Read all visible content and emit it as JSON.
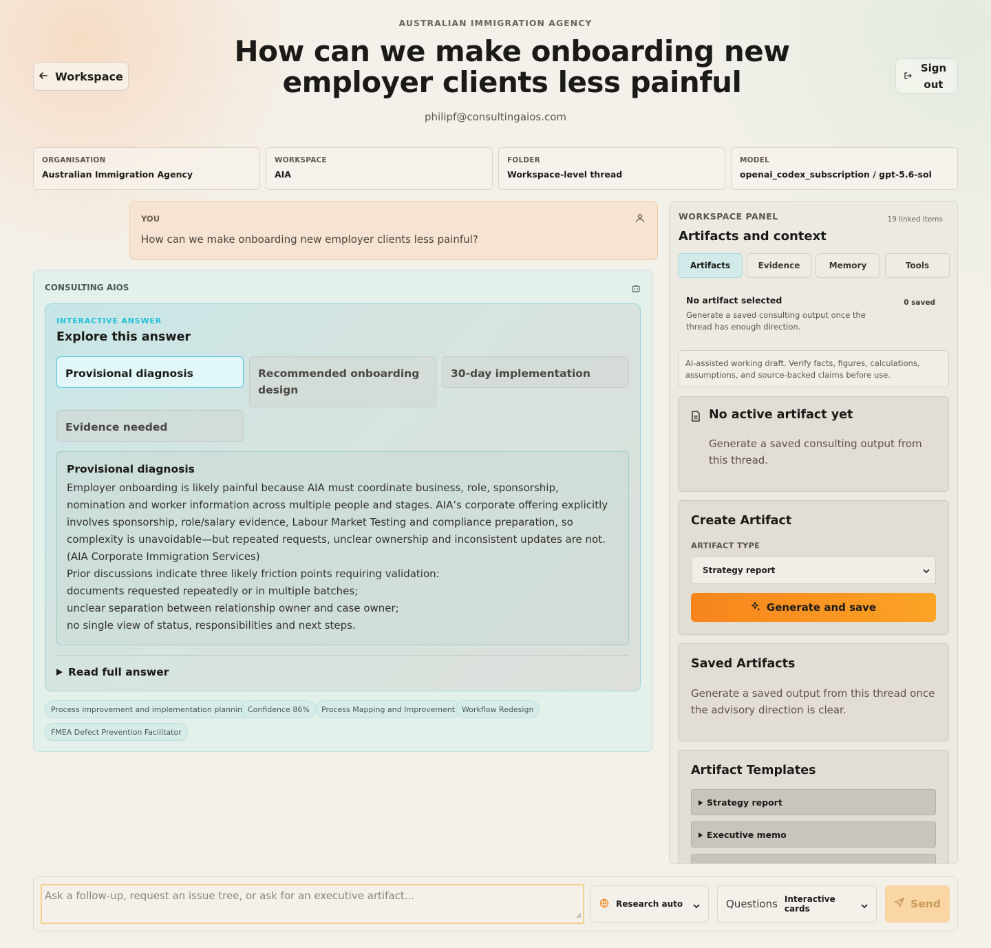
{
  "header": {
    "eyebrow": "AUSTRALIAN IMMIGRATION AGENCY",
    "title": "How can we make onboarding new employer clients less painful",
    "email": "philipf@consultingaios.com",
    "back_label": "Workspace",
    "signout_label": "Sign out"
  },
  "meta": [
    {
      "key": "ORGANISATION",
      "value": "Australian Immigration Agency"
    },
    {
      "key": "WORKSPACE",
      "value": "AIA"
    },
    {
      "key": "FOLDER",
      "value": "Workspace-level thread"
    },
    {
      "key": "MODEL",
      "value": "openai_codex_subscription / gpt-5.6-sol"
    }
  ],
  "user_message": {
    "label": "YOU",
    "text": "How can we make onboarding new employer clients less painful?"
  },
  "assistant": {
    "label": "CONSULTING AIOS",
    "eyebrow": "INTERACTIVE ANSWER",
    "heading": "Explore this answer",
    "tabs": [
      "Provisional diagnosis",
      "Recommended onboarding design",
      "30-day implementation",
      "Evidence needed"
    ],
    "active_tab": "Provisional diagnosis",
    "section_title": "Provisional diagnosis",
    "paragraphs": [
      "Employer onboarding is likely painful because AIA must coordinate business, role, sponsorship, nomination and worker information across multiple people and stages. AIA’s corporate offering explicitly involves sponsorship, role/salary evidence, Labour Market Testing and compliance preparation, so complexity is unavoidable—but repeated requests, unclear ownership and inconsistent updates are not. (AIA Corporate Immigration Services)",
      "Prior discussions indicate three likely friction points requiring validation:",
      "documents requested repeatedly or in multiple batches;",
      "unclear separation between relationship owner and case owner;",
      "no single view of status, responsibilities and next steps."
    ],
    "read_full": "Read full answer",
    "chips": [
      "Process improvement and implementation planning",
      "Confidence 86%",
      "Process Mapping and Improvement",
      "Workflow Redesign",
      "FMEA Defect Prevention Facilitator"
    ]
  },
  "panel": {
    "eyebrow": "WORKSPACE PANEL",
    "count": "19 linked items",
    "heading": "Artifacts and context",
    "tabs": [
      "Artifacts",
      "Evidence",
      "Memory",
      "Tools"
    ],
    "active_tab": "Artifacts",
    "selected_title": "No artifact selected",
    "selected_desc": "Generate a saved consulting output once the thread has enough direction.",
    "saved_count": "0 saved",
    "disclaimer": "AI-assisted working draft. Verify facts, figures, calculations, assumptions, and source-backed claims before use.",
    "no_active_title": "No active artifact yet",
    "no_active_desc": "Generate a saved consulting output from this thread.",
    "create_title": "Create Artifact",
    "artifact_type_label": "ARTIFACT TYPE",
    "artifact_type_value": "Strategy report",
    "generate_label": "Generate and save",
    "saved_title": "Saved Artifacts",
    "saved_desc": "Generate a saved output from this thread once the advisory direction is clear.",
    "templates_title": "Artifact Templates",
    "templates": [
      "Strategy report",
      "Executive memo"
    ]
  },
  "composer": {
    "placeholder": "Ask a follow-up, request an issue tree, or ask for an executive artifact...",
    "research_label": "Research auto",
    "questions_label": "Questions",
    "questions_value": "Interactive cards",
    "send_label": "Send"
  },
  "colors": {
    "accent_orange": "#f7841d",
    "accent_cyan": "#22c1d8"
  }
}
